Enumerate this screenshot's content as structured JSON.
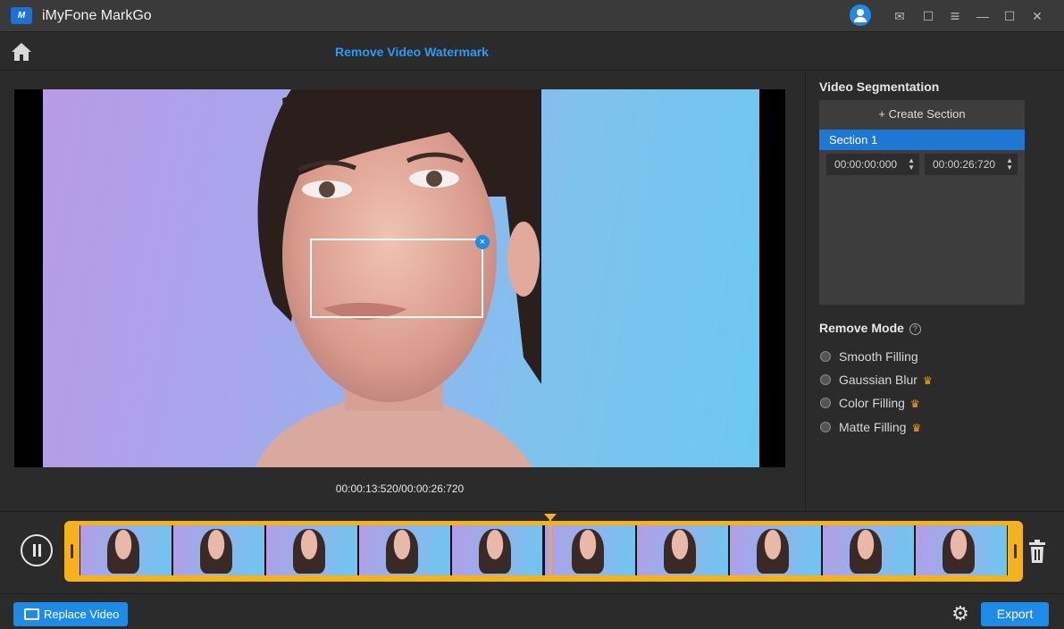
{
  "app": {
    "title": "iMyFone MarkGo",
    "logo_text": "M"
  },
  "titlebar": {
    "icons": [
      "user-icon",
      "mail-icon",
      "chat-icon",
      "menu-icon",
      "minimize-icon",
      "maximize-icon",
      "close-icon"
    ],
    "glyphs": {
      "mail": "✉",
      "chat": "☐",
      "menu": "≡",
      "minimize": "—",
      "maximize": "☐",
      "close": "✕"
    }
  },
  "toolbar": {
    "page_title": "Remove Video Watermark"
  },
  "preview": {
    "timecode": "00:00:13:520/00:00:26:720",
    "selection_close": "×"
  },
  "segmentation": {
    "heading": "Video Segmentation",
    "create_label": "+ Create Section",
    "sections": [
      {
        "label": "Section 1",
        "start": "00:00:00:000",
        "end": "00:00:26:720"
      }
    ]
  },
  "remove_mode": {
    "heading": "Remove Mode",
    "help": "?",
    "options": [
      {
        "label": "Smooth Filling",
        "premium": false
      },
      {
        "label": "Gaussian Blur",
        "premium": true
      },
      {
        "label": "Color Filling",
        "premium": true
      },
      {
        "label": "Matte Filling",
        "premium": true
      }
    ],
    "premium_glyph": "♛"
  },
  "timeline": {
    "thumbnail_count": 10,
    "playhead_fraction": 0.506
  },
  "bottom": {
    "replace_label": "Replace Video",
    "export_label": "Export",
    "settings_glyph": "⚙"
  },
  "colors": {
    "accent": "#1e8be6",
    "title_accent": "#2a9bf5",
    "timeline_frame": "#f5b21c",
    "crown": "#f3a31a"
  }
}
